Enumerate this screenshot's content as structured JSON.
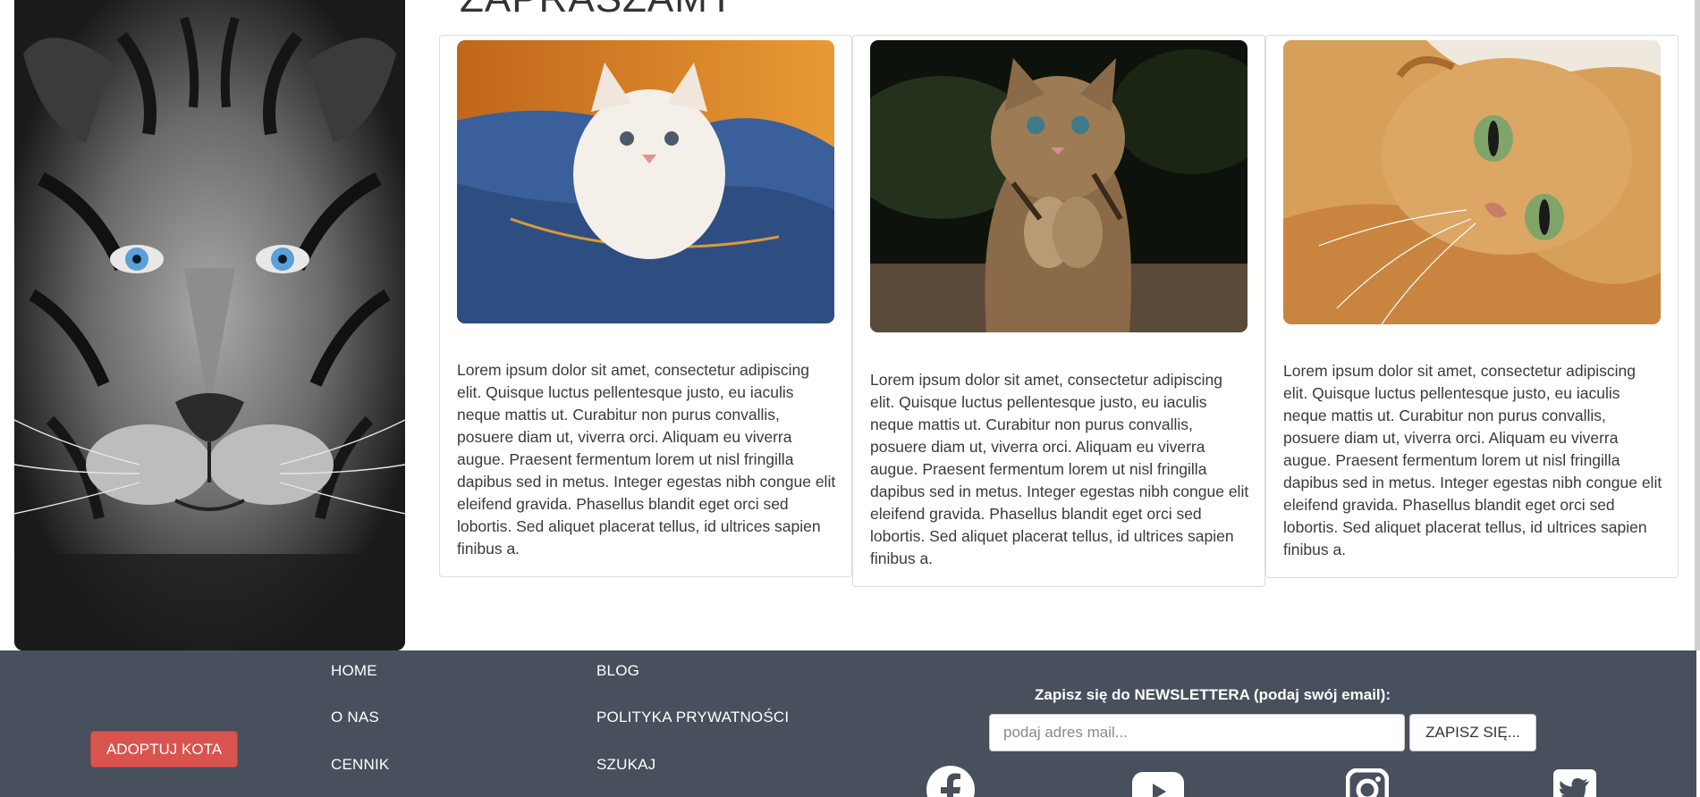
{
  "main": {
    "heading": "ZAPRASZAMY",
    "cards": [
      {
        "text": "Lorem ipsum dolor sit amet, consectetur adipiscing elit. Quisque luctus pellentesque justo, eu iaculis neque mattis ut. Curabitur non purus convallis, posuere diam ut, viverra orci. Aliquam eu viverra augue. Praesent fermentum lorem ut nisl fringilla dapibus sed in metus. Integer egestas nibh congue elit eleifend gravida. Phasellus blandit eget orci sed lobortis. Sed aliquet placerat tellus, id ultrices sapien finibus a."
      },
      {
        "text": "Lorem ipsum dolor sit amet, consectetur adipiscing elit. Quisque luctus pellentesque justo, eu iaculis neque mattis ut. Curabitur non purus convallis, posuere diam ut, viverra orci. Aliquam eu viverra augue. Praesent fermentum lorem ut nisl fringilla dapibus sed in metus. Integer egestas nibh congue elit eleifend gravida. Phasellus blandit eget orci sed lobortis. Sed aliquet placerat tellus, id ultrices sapien finibus a."
      },
      {
        "text": "Lorem ipsum dolor sit amet, consectetur adipiscing elit. Quisque luctus pellentesque justo, eu iaculis neque mattis ut. Curabitur non purus convallis, posuere diam ut, viverra orci. Aliquam eu viverra augue. Praesent fermentum lorem ut nisl fringilla dapibus sed in metus. Integer egestas nibh congue elit eleifend gravida. Phasellus blandit eget orci sed lobortis. Sed aliquet placerat tellus, id ultrices sapien finibus a."
      }
    ]
  },
  "footer": {
    "adopt_label": "ADOPTUJ KOTA",
    "nav": {
      "home": "HOME",
      "about": "O NAS",
      "pricing": "CENNIK",
      "blog": "BLOG",
      "privacy": "POLITYKA PRYWATNOŚCI",
      "search": "SZUKAJ"
    },
    "newsletter": {
      "label": "Zapisz się do NEWSLETTERA (podaj swój email):",
      "placeholder": "podaj adres mail...",
      "button": "ZAPISZ SIĘ..."
    },
    "social": [
      "facebook-icon",
      "youtube-icon",
      "instagram-icon",
      "twitter-icon"
    ]
  },
  "colors": {
    "footer_bg": "#47505c",
    "adopt_button": "#d9534f"
  }
}
